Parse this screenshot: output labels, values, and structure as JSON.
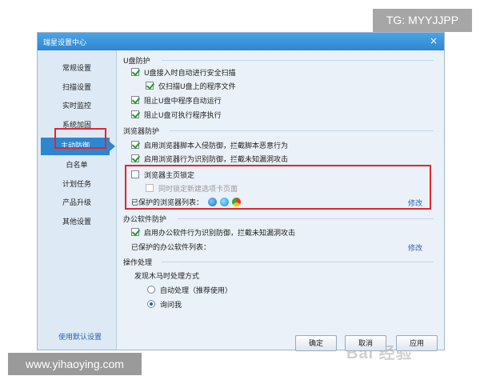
{
  "overlays": {
    "tg": "TG: MYYJJPP",
    "url": "www.yihaoying.com"
  },
  "window": {
    "title": "瑞星设置中心",
    "close_symbol": "×"
  },
  "sidebar": {
    "items": [
      {
        "label": "常规设置"
      },
      {
        "label": "扫描设置"
      },
      {
        "label": "实时监控"
      },
      {
        "label": "系统加固"
      },
      {
        "label": "主动防御",
        "active": true
      },
      {
        "label": "白名单"
      },
      {
        "label": "计划任务"
      },
      {
        "label": "产品升级"
      },
      {
        "label": "其他设置"
      }
    ],
    "default_link": "使用默认设置"
  },
  "usb": {
    "title": "U盘防护",
    "options": [
      {
        "label": "U盘接入时自动进行安全扫描",
        "checked": true
      },
      {
        "label": "仅扫描U盘上的程序文件",
        "checked": true
      },
      {
        "label": "阻止U盘中程序自动运行",
        "checked": true
      },
      {
        "label": "阻止U盘可执行程序执行",
        "checked": true
      }
    ]
  },
  "browser": {
    "title": "浏览器防护",
    "options": [
      {
        "label": "启用浏览器脚本入侵防御，拦截脚本恶意行为",
        "checked": true
      },
      {
        "label": "启用浏览器行为识别防御，拦截未知漏洞攻击",
        "checked": true
      },
      {
        "label": "浏览器主页锁定",
        "checked": false
      },
      {
        "label": "同时锁定新建选项卡页面",
        "checked": false,
        "disabled": true
      }
    ],
    "protected_label": "已保护的浏览器列表：",
    "browser_icons": [
      "ie-icon",
      "edge-icon",
      "chrome-icon"
    ],
    "edit_label": "修改"
  },
  "office": {
    "title": "办公软件防护",
    "option": {
      "label": "启用办公软件行为识别防御，拦截未知漏洞攻击",
      "checked": true
    },
    "protected_label": "已保护的办公软件列表：",
    "edit_label": "修改"
  },
  "handling": {
    "title": "操作处理",
    "subtitle": "发现木马时处理方式",
    "options": [
      {
        "label": "自动处理（推荐使用）",
        "selected": false
      },
      {
        "label": "询问我",
        "selected": true
      }
    ]
  },
  "buttons": {
    "ok": "确定",
    "cancel": "取消",
    "apply": "应用"
  },
  "watermark": "Bai 经验",
  "colors": {
    "accent": "#2f86cf",
    "highlight": "#e0262f",
    "link": "#2a62b0"
  }
}
